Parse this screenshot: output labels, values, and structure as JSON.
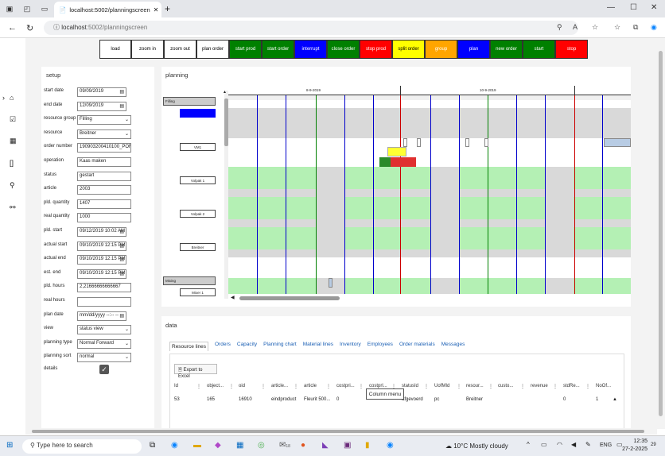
{
  "browser": {
    "tab_title": "localhost:5002/planningscreen",
    "url_host": "localhost",
    "url_path": ":5002/planningscreen"
  },
  "toolbar": [
    {
      "label": "load",
      "bg": "#ffffff",
      "fg": "#000"
    },
    {
      "label": "zoom in",
      "bg": "#ffffff",
      "fg": "#000"
    },
    {
      "label": "zoom out",
      "bg": "#ffffff",
      "fg": "#000"
    },
    {
      "label": "plan order",
      "bg": "#ffffff",
      "fg": "#000"
    },
    {
      "label": "start prod",
      "bg": "#008000",
      "fg": "#fff"
    },
    {
      "label": "start order",
      "bg": "#008000",
      "fg": "#fff"
    },
    {
      "label": "interrupt",
      "bg": "#0000ff",
      "fg": "#fff"
    },
    {
      "label": "close order",
      "bg": "#008000",
      "fg": "#fff"
    },
    {
      "label": "stop prod",
      "bg": "#ff0000",
      "fg": "#fff"
    },
    {
      "label": "split order",
      "bg": "#ffff00",
      "fg": "#000"
    },
    {
      "label": "group",
      "bg": "#ffa500",
      "fg": "#fff"
    },
    {
      "label": "plan",
      "bg": "#0000ff",
      "fg": "#fff"
    },
    {
      "label": "new order",
      "bg": "#008000",
      "fg": "#fff"
    },
    {
      "label": "start",
      "bg": "#008000",
      "fg": "#fff"
    },
    {
      "label": "stop",
      "bg": "#ff0000",
      "fg": "#fff"
    }
  ],
  "setup": {
    "title": "setup",
    "fields": [
      {
        "label": "start date",
        "value": "09/09/2019",
        "kind": "date"
      },
      {
        "label": "end date",
        "value": "12/09/2019",
        "kind": "date"
      },
      {
        "label": "resource group",
        "value": "Filling",
        "kind": "select"
      },
      {
        "label": "resource",
        "value": "Breitner",
        "kind": "select"
      },
      {
        "label": "order number",
        "value": "190903200410100_PORe",
        "kind": "text"
      },
      {
        "label": "operation",
        "value": "Kaas maken",
        "kind": "text"
      },
      {
        "label": "status",
        "value": "gestart",
        "kind": "text"
      },
      {
        "label": "article",
        "value": "2003",
        "kind": "text"
      },
      {
        "label": "pld. quantity",
        "value": "1407",
        "kind": "text"
      },
      {
        "label": "real quantity",
        "value": "1000",
        "kind": "text"
      },
      {
        "label": "pld. start",
        "value": "09/12/2019 10:02 AM",
        "kind": "date"
      },
      {
        "label": "actual start",
        "value": "09/10/2019 12:15 PM",
        "kind": "date"
      },
      {
        "label": "actual end",
        "value": "09/10/2019 12:15 PM",
        "kind": "date"
      },
      {
        "label": "est. end",
        "value": "09/10/2019 12:15 PM",
        "kind": "date"
      },
      {
        "label": "pld. hours",
        "value": "2,21666666666667",
        "kind": "text"
      },
      {
        "label": "real hours",
        "value": "",
        "kind": "text"
      },
      {
        "label": "plan date",
        "value": "mm/dd/yyyy --:-- --",
        "kind": "date"
      },
      {
        "label": "view",
        "value": "status view",
        "kind": "select"
      },
      {
        "label": "planning type",
        "value": "Normal Forward",
        "kind": "select"
      },
      {
        "label": "planning sort",
        "value": "normal",
        "kind": "select"
      }
    ],
    "details_label": "details",
    "details_checked": true
  },
  "planning": {
    "title": "planning",
    "dates": [
      "8-9-2019",
      "10-9-2019"
    ],
    "groups": [
      {
        "name": "Filling"
      },
      {
        "name": "Mixing"
      }
    ],
    "resources": [
      "VM1",
      "Volpak 1",
      "Volpak 2",
      "Breitner",
      "Mixer 1"
    ]
  },
  "data": {
    "title": "data",
    "tabs": [
      "Resource lines",
      "Orders",
      "Capacity",
      "Planning chart",
      "Material lines",
      "Inventory",
      "Employees",
      "Order materials",
      "Messages"
    ],
    "export_label": "Export to Excel",
    "columns": [
      "Id",
      "object...",
      "oid",
      "article...",
      "article",
      "costpri...",
      "costprl...",
      "statusId",
      "UofMId",
      "resour...",
      "custo...",
      "revenue",
      "stdRe...",
      "NoOf..."
    ],
    "rows": [
      [
        "53",
        "165",
        "16910",
        "eindproduct",
        "Fleurit 500...",
        "0",
        "",
        "afgevoerd",
        "pc",
        "Breitner",
        "",
        "",
        "0",
        "1"
      ]
    ],
    "column_menu": "Column menu"
  },
  "taskbar": {
    "search": "Type here to search",
    "weather": "10°C  Mostly cloudy",
    "lang": "ENG",
    "time": "12:35",
    "date": "27-2-2025",
    "badge": "18",
    "notif": "29"
  }
}
